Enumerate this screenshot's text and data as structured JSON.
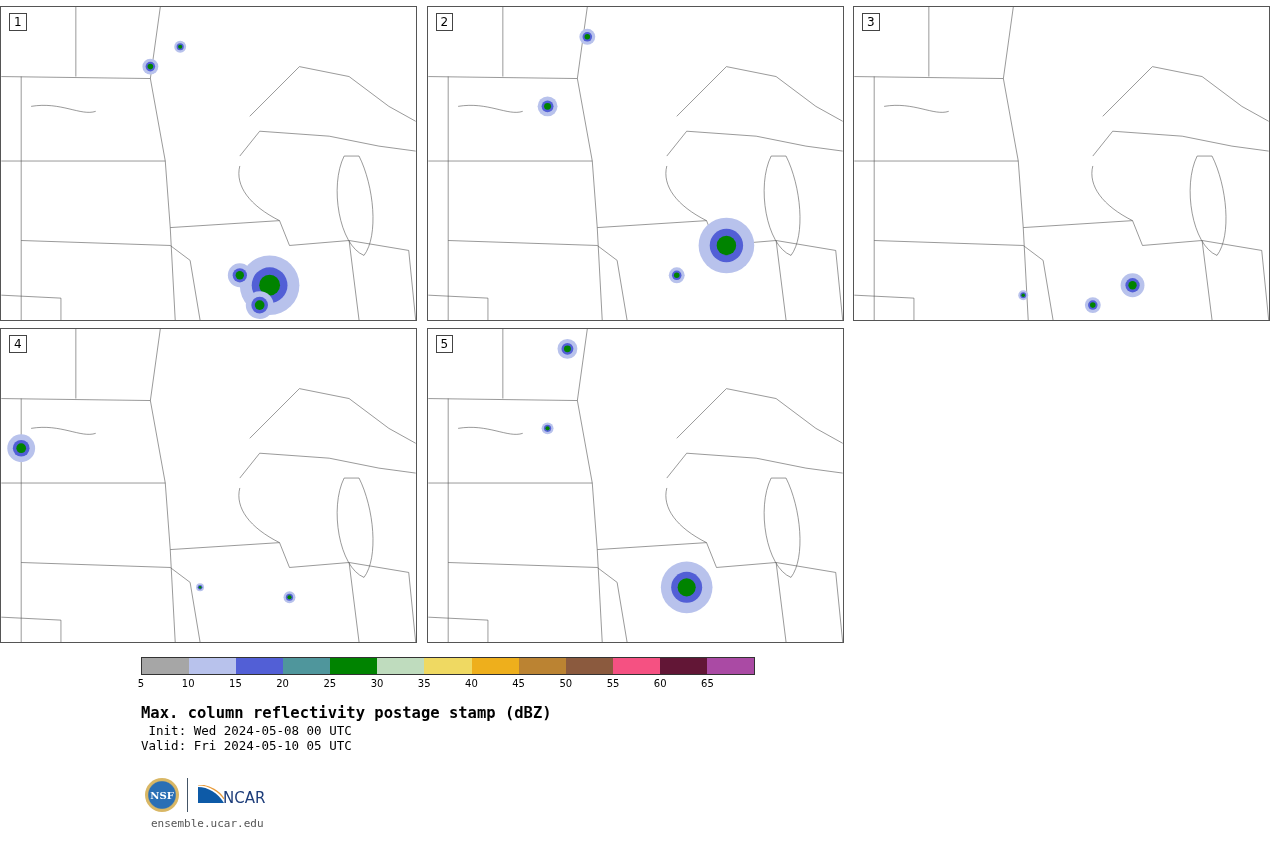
{
  "panels": [
    {
      "label": "1"
    },
    {
      "label": "2"
    },
    {
      "label": "3"
    },
    {
      "label": "4"
    },
    {
      "label": "5"
    }
  ],
  "colorbar": {
    "segments": [
      {
        "color": "#a6a6a6"
      },
      {
        "color": "#b8c2ec"
      },
      {
        "color": "#525fd6"
      },
      {
        "color": "#4f969c"
      },
      {
        "color": "#008300"
      },
      {
        "color": "#bfdcbe"
      },
      {
        "color": "#efd962"
      },
      {
        "color": "#eeaf1c"
      },
      {
        "color": "#bb8332"
      },
      {
        "color": "#8b5a3e"
      },
      {
        "color": "#f55182"
      },
      {
        "color": "#621636"
      },
      {
        "color": "#aa4aa4"
      }
    ],
    "ticks": [
      "5",
      "10",
      "15",
      "20",
      "25",
      "30",
      "35",
      "40",
      "45",
      "50",
      "55",
      "60",
      "65"
    ]
  },
  "title": "Max. column reflectivity postage stamp (dBZ)",
  "init": " Init: Wed 2024-05-08 00 UTC",
  "valid": "Valid: Fri 2024-05-10 05 UTC",
  "logo": {
    "seal": "NSF",
    "wordmark": "NCAR"
  },
  "footer_link": "ensemble.ucar.edu"
}
